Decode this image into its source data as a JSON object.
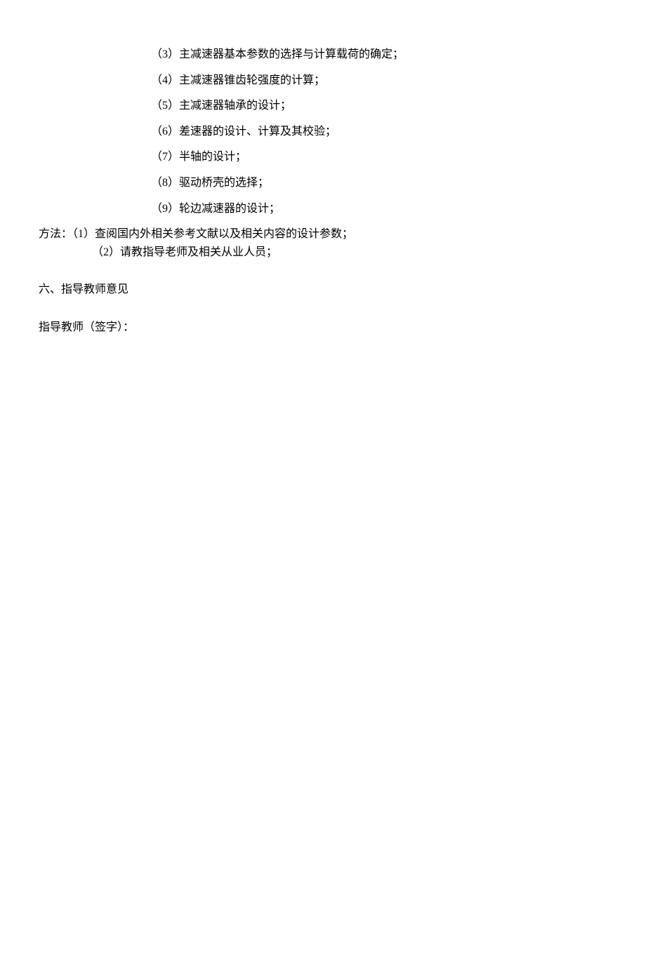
{
  "numbered_items": [
    "（3）主减速器基本参数的选择与计算载荷的确定；",
    "（4）主减速器锥齿轮强度的计算；",
    "（5）主减速器轴承的设计；",
    "（6）差速器的设计、计算及其校验；",
    "（7）半轴的设计；",
    "（8）驱动桥壳的选择；",
    "（9）轮边减速器的设计；"
  ],
  "method": {
    "label": "方法：",
    "line1": "（1）查阅国内外相关参考文献以及相关内容的设计参数；",
    "line2": "（2）请教指导老师及相关从业人员；"
  },
  "section_heading": "六、指导教师意见",
  "signature": "指导教师（签字）："
}
